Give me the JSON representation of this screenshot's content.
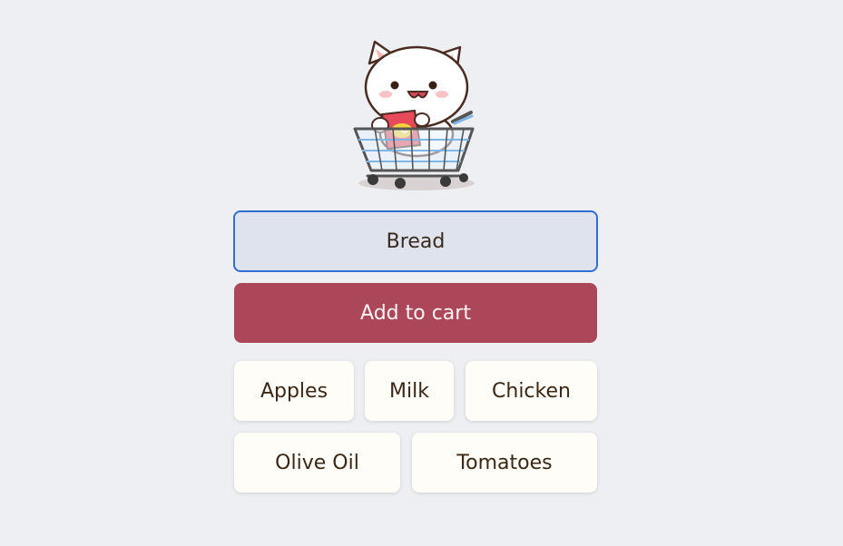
{
  "form": {
    "item_value": "Bread",
    "add_label": "Add to cart"
  },
  "suggestions": [
    {
      "label": "Apples"
    },
    {
      "label": "Milk"
    },
    {
      "label": "Chicken"
    },
    {
      "label": "Olive Oil"
    },
    {
      "label": "Tomatoes"
    }
  ],
  "colors": {
    "background": "#eeeff3",
    "input_background": "#dfe3ee",
    "input_border": "#2f6fd0",
    "button_background": "#ab4759",
    "chip_background": "#fffdf8"
  },
  "icons": {
    "mascot": "cat-in-shopping-cart-icon"
  }
}
